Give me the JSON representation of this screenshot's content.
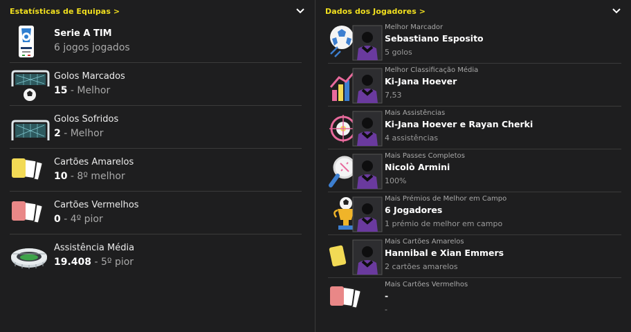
{
  "team_panel": {
    "title": "Estatísticas de Equipas >",
    "rows": [
      {
        "icon": "serie-a-logo-icon",
        "label": "Serie A TIM",
        "value": "",
        "rest": "6 jogos jogados"
      },
      {
        "icon": "goal-net-ball-icon",
        "label": "Golos Marcados",
        "value": "15",
        "rest": " - Melhor"
      },
      {
        "icon": "goal-net-icon",
        "label": "Golos Sofridos",
        "value": "2",
        "rest": " - Melhor"
      },
      {
        "icon": "yellow-cards-icon",
        "label": "Cartões Amarelos",
        "value": "10",
        "rest": " - 8º melhor"
      },
      {
        "icon": "red-cards-icon",
        "label": "Cartões Vermelhos",
        "value": "0",
        "rest": " - 4º pior"
      },
      {
        "icon": "stadium-icon",
        "label": "Assistência Média",
        "value": "19.408",
        "rest": " - 5º pior"
      }
    ]
  },
  "player_panel": {
    "title": "Dados dos Jogadores >",
    "rows": [
      {
        "icon": "top-scorer-icon",
        "category": "Melhor Marcador",
        "name": "Sebastiano Esposito",
        "detail": "5 golos"
      },
      {
        "icon": "rating-chart-icon",
        "category": "Melhor Classificação Média",
        "name": "Ki-Jana Hoever",
        "detail": "7,53"
      },
      {
        "icon": "target-icon",
        "category": "Mais Assistências",
        "name": "Ki-Jana Hoever e Rayan Cherki",
        "detail": "4 assistências"
      },
      {
        "icon": "pass-magnifier-icon",
        "category": "Mais Passes Completos",
        "name": "Nicolò Armini",
        "detail": "100%"
      },
      {
        "icon": "trophy-icon",
        "category": "Mais Prémios de Melhor em Campo",
        "name": "6 Jogadores",
        "detail": "1 prémio de melhor em campo"
      },
      {
        "icon": "yellow-card-icon",
        "category": "Mais Cartões Amarelos",
        "name": "Hannibal e Xian Emmers",
        "detail": "2 cartões amarelos"
      },
      {
        "icon": "red-cards-icon",
        "category": "Mais Cartões Vermelhos",
        "name": "-",
        "detail": "-"
      }
    ]
  },
  "colors": {
    "accent": "#f2e01f",
    "bg": "#1e1e1f",
    "divider": "#3b3b3b",
    "jersey": "#6a3a9e"
  }
}
